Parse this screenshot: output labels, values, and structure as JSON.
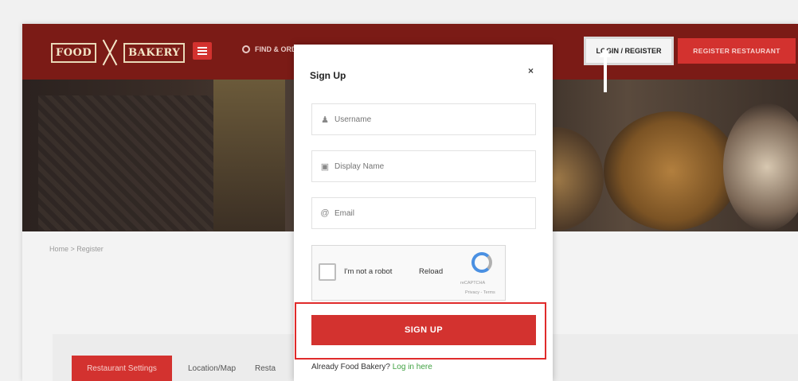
{
  "header": {
    "logo_left": "FOOD",
    "logo_right": "BAKERY",
    "find_text": "FIND & ORDER",
    "login_register": "LOGIN / REGISTER",
    "register_restaurant": "REGISTER RESTAURANT"
  },
  "page": {
    "breadcrumb": "Home > Register",
    "tabs": [
      "Restaurant Settings",
      "Location/Map",
      "Resta"
    ]
  },
  "modal": {
    "title": "Sign Up",
    "close": "×",
    "fields": [
      {
        "placeholder": "Username",
        "icon": "user-icon"
      },
      {
        "placeholder": "Display Name",
        "icon": "id-card-icon"
      },
      {
        "placeholder": "Email",
        "icon": "at-icon"
      }
    ],
    "captcha": {
      "label": "I'm not a robot",
      "reload": "Reload",
      "brand": "reCAPTCHA",
      "privacy": "Privacy - Terms"
    },
    "signup_button": "SIGN UP",
    "already_text": "Already Food Bakery?",
    "login_link": "Log in here"
  },
  "colors": {
    "brand_red": "#d3322f",
    "header_dark": "#7b1b16",
    "highlight_red": "#e02b2b",
    "link_green": "#3fa142"
  }
}
